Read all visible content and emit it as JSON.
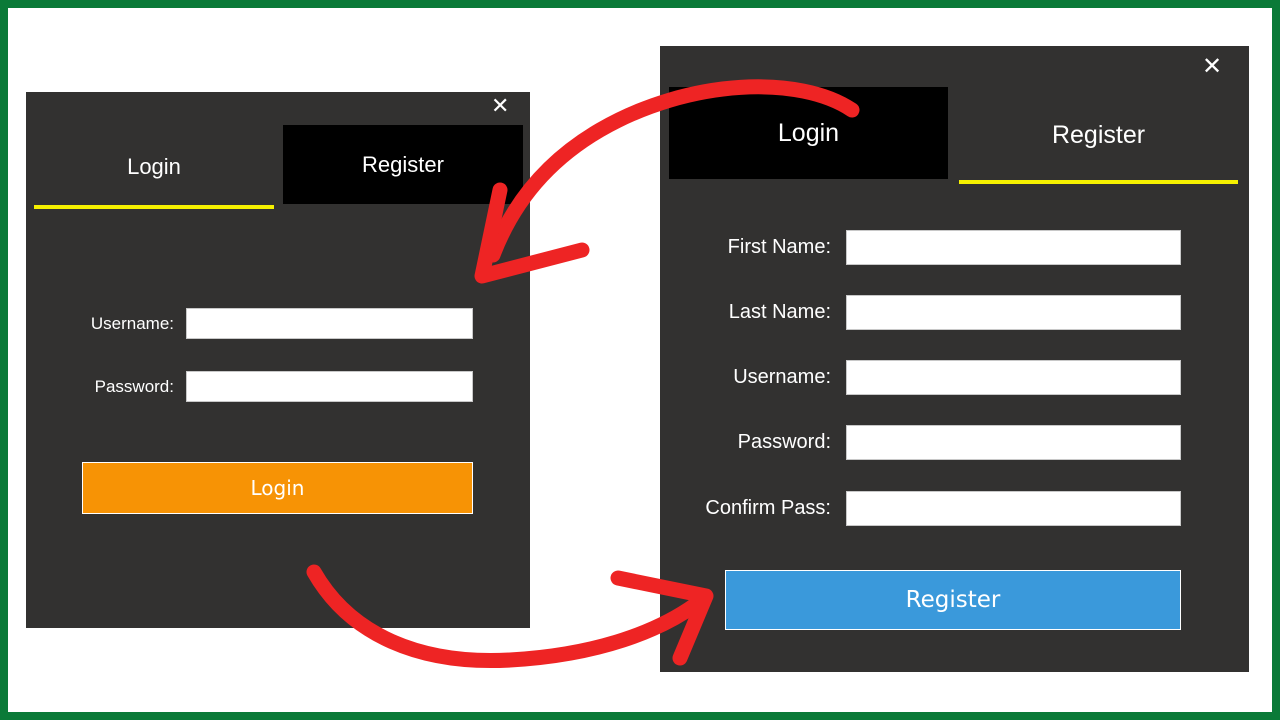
{
  "colors": {
    "frame": "#0a7a38",
    "panel": "#323130",
    "tab_inactive": "#000000",
    "active_underline": "#f5f000",
    "login_button": "#f79305",
    "register_button": "#3a99db",
    "arrow": "#ee2424"
  },
  "login_panel": {
    "close_glyph": "✕",
    "tabs": [
      {
        "label": "Login",
        "active": true
      },
      {
        "label": "Register",
        "active": false
      }
    ],
    "fields": [
      {
        "label": "Username:",
        "value": "",
        "placeholder": ""
      },
      {
        "label": "Password:",
        "value": "",
        "placeholder": ""
      }
    ],
    "submit_label": "Login"
  },
  "register_panel": {
    "close_glyph": "✕",
    "tabs": [
      {
        "label": "Login",
        "active": false
      },
      {
        "label": "Register",
        "active": true
      }
    ],
    "fields": [
      {
        "label": "First Name:",
        "value": "",
        "placeholder": ""
      },
      {
        "label": "Last Name:",
        "value": "",
        "placeholder": ""
      },
      {
        "label": "Username:",
        "value": "",
        "placeholder": ""
      },
      {
        "label": "Password:",
        "value": "",
        "placeholder": ""
      },
      {
        "label": "Confirm Pass:",
        "value": "",
        "placeholder": ""
      }
    ],
    "submit_label": "Register"
  }
}
